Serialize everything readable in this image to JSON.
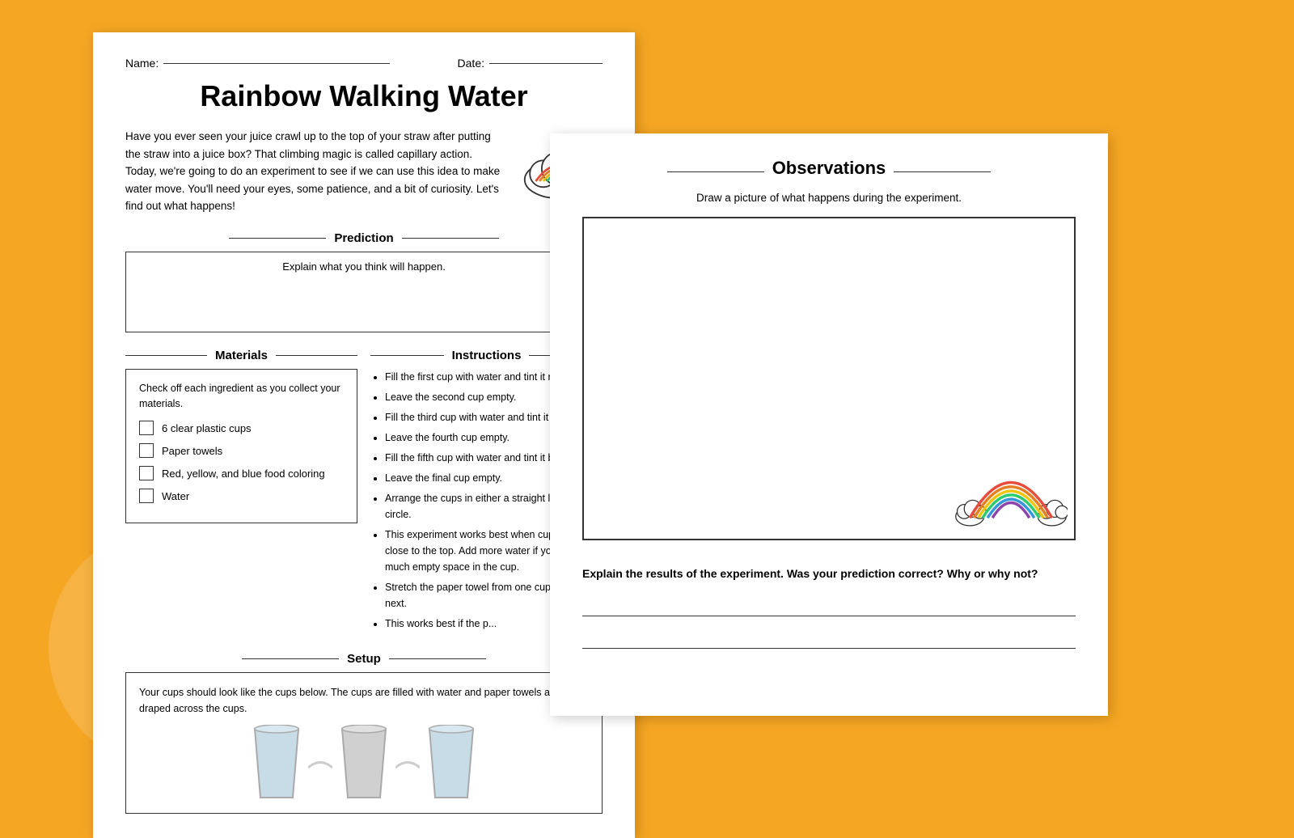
{
  "page1": {
    "name_label": "Name:",
    "date_label": "Date:",
    "title": "Rainbow Walking Water",
    "intro": "Have you ever seen your juice crawl up to the top of your straw after putting the straw into a juice box? That climbing magic is called capillary action. Today, we're going to do an experiment to see if we can use this idea to make water move. You'll need your eyes, some patience, and a bit of curiosity. Let's find out what happens!",
    "prediction_header": "Prediction",
    "prediction_subtitle": "Explain what you think will happen.",
    "materials_header": "Materials",
    "materials_desc": "Check off each ingredient as you collect your materials.",
    "checklist": [
      "6 clear plastic cups",
      "Paper towels",
      "Red, yellow, and blue food coloring",
      "Water"
    ],
    "instructions_header": "Instructions",
    "instructions": [
      "Fill the first cup with water and tint it red.",
      "Leave the second cup empty.",
      "Fill the third cup with water and tint it yellow.",
      "Leave the fourth cup empty.",
      "Fill the fifth cup with water and tint it blue.",
      "Leave the final cup empty.",
      "Arrange the cups in either a straight line or a circle.",
      "This experiment works best when cups are filled close to the top. Add more water if you have too much empty space in the cup.",
      "Stretch the paper towel from one cup to the next.",
      "This works best if the paper towel..."
    ],
    "setup_header": "Setup",
    "setup_text": "Your cups should look like the cups below. The cups are filled with water and paper towels are draped across the cups."
  },
  "page2": {
    "observations_header": "Observations",
    "observations_subtitle": "Draw a picture of what happens during the experiment.",
    "results_text": "Explain the results of the experiment. Was your prediction correct? Why or why not?"
  }
}
